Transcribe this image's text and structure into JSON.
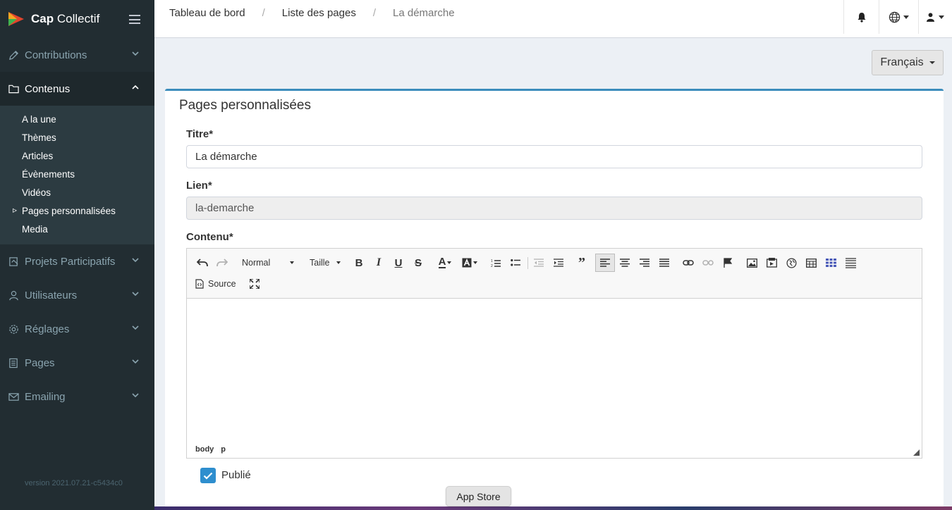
{
  "brand": {
    "name_bold": "Cap",
    "name_rest": " Collectif"
  },
  "sidebar": {
    "items": [
      {
        "label": "Contributions"
      },
      {
        "label": "Contenus"
      },
      {
        "label": "Projets Participatifs"
      },
      {
        "label": "Utilisateurs"
      },
      {
        "label": "Réglages"
      },
      {
        "label": "Pages"
      },
      {
        "label": "Emailing"
      }
    ],
    "subitems": [
      "A la une",
      "Thèmes",
      "Articles",
      "Évènements",
      "Vidéos",
      "Pages personnalisées",
      "Media"
    ],
    "version": "version 2021.07.21-c5434c0"
  },
  "breadcrumb": {
    "items": [
      "Tableau de bord",
      "Liste des pages",
      "La démarche"
    ],
    "separator": "/"
  },
  "language": {
    "selected": "Français"
  },
  "form": {
    "title": "Pages personnalisées",
    "titre_label": "Titre*",
    "titre_value": "La démarche",
    "lien_label": "Lien*",
    "lien_value": "la-demarche",
    "contenu_label": "Contenu*",
    "format_value": "Normal",
    "size_value": "Taille",
    "source_label": "Source",
    "path": [
      "body",
      "p"
    ],
    "publie_label": "Publié",
    "publie_checked": true
  },
  "dock": {
    "tooltip": "App Store"
  },
  "colors": {
    "sidebar_bg": "#222d32",
    "accent": "#3c8dbc",
    "checkbox": "#2e8ece"
  }
}
